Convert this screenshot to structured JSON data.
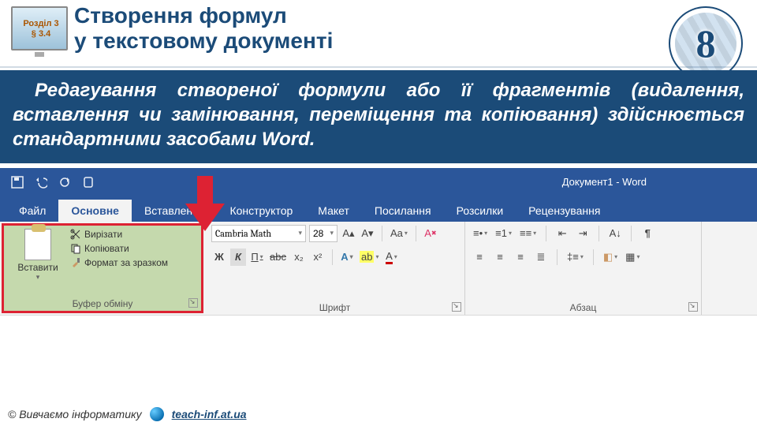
{
  "section": {
    "chapter": "Розділ 3",
    "paragraph": "§ 3.4"
  },
  "title": {
    "line1": "Створення формул",
    "line2": "у текстовому документі"
  },
  "grade": "8",
  "description": "Редагування створеної формули або її фрагментів (видалення, вставлення чи замінювання, переміщення та копіювання) здійснюється стандартними засобами Word.",
  "word": {
    "doc_title": "Документ1 - Word",
    "tabs": [
      "Файл",
      "Основне",
      "Вставлення",
      "Конструктор",
      "Макет",
      "Посилання",
      "Розсилки",
      "Рецензування"
    ],
    "active_tab_index": 1,
    "clipboard": {
      "paste": "Вставити",
      "cut": "Вирізати",
      "copy": "Копіювати",
      "format_painter": "Формат за зразком",
      "group_title": "Буфер обміну"
    },
    "font": {
      "name": "Cambria Math",
      "size": "28",
      "grow": "A▴",
      "shrink": "A▾",
      "case": "Aa",
      "clear": "A",
      "bold": "Ж",
      "italic": "К",
      "underline": "П",
      "strike": "abc",
      "sub": "x₂",
      "sup": "x²",
      "texteffects": "A",
      "highlight": "ab",
      "color": "A",
      "group_title": "Шрифт"
    },
    "para": {
      "group_title": "Абзац",
      "sort": "А↓",
      "pilcrow": "¶"
    }
  },
  "footer": {
    "copyright": "© Вивчаємо інформатику",
    "url": "teach-inf.at.ua"
  }
}
